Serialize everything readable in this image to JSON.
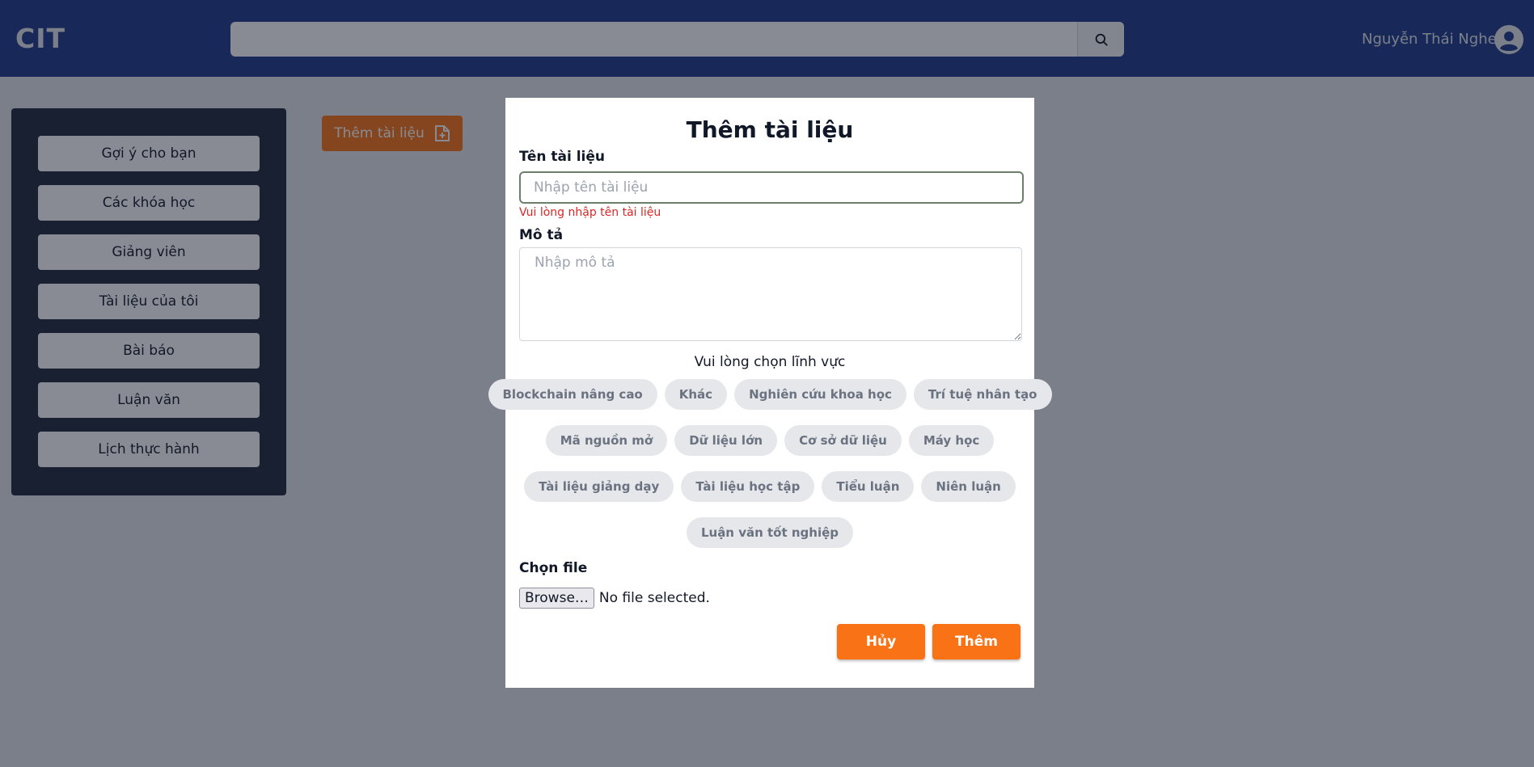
{
  "header": {
    "logo": "CIT",
    "search_placeholder": "",
    "username": "Nguyễn Thái Nghe"
  },
  "sidebar": {
    "items": [
      {
        "label": "Gợi ý cho bạn"
      },
      {
        "label": "Các khóa học"
      },
      {
        "label": "Giảng viên"
      },
      {
        "label": "Tài liệu của tôi"
      },
      {
        "label": "Bài báo"
      },
      {
        "label": "Luận văn"
      },
      {
        "label": "Lịch thực hành"
      }
    ]
  },
  "main": {
    "add_document_label": "Thêm tài liệu"
  },
  "modal": {
    "title": "Thêm tài liệu",
    "name_label": "Tên tài liệu",
    "name_placeholder": "Nhập tên tài liệu",
    "name_value": "",
    "name_error": "Vui lòng nhập tên tài liệu",
    "desc_label": "Mô tả",
    "desc_placeholder": "Nhập mô tả",
    "field_prompt": "Vui lòng chọn lĩnh vực",
    "fields_rows": [
      [
        "Blockchain nâng cao",
        "Khác",
        "Nghiên cứu khoa học",
        "Trí tuệ nhân tạo"
      ],
      [
        "Mã nguồn mở",
        "Dữ liệu lớn",
        "Cơ sở dữ liệu",
        "Máy học"
      ],
      [
        "Tài liệu giảng dạy",
        "Tài liệu học tập",
        "Tiểu luận",
        "Niên luận"
      ],
      [
        "Luận văn tốt nghiệp"
      ]
    ],
    "file_label": "Chọn file",
    "browse_label": "Browse…",
    "file_status": "No file selected.",
    "cancel_label": "Hủy",
    "submit_label": "Thêm"
  },
  "colors": {
    "header_bg": "#1e3a8a",
    "sidebar_bg": "#1e293b",
    "accent": "#f97316",
    "error": "#dc2626"
  },
  "icons": [
    "search-icon",
    "user-avatar-icon",
    "file-plus-icon"
  ]
}
